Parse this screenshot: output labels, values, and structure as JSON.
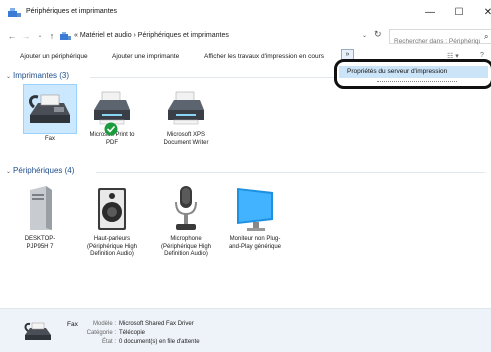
{
  "window": {
    "title": "Périphériques et imprimantes",
    "minimize": "—",
    "maximize": "☐",
    "close": "✕"
  },
  "address": {
    "back": "←",
    "forward": "→",
    "recent": "⌄",
    "up": "↑",
    "path": "« Matériel et audio  ›  Périphériques et imprimantes",
    "dropdown": "⌄",
    "refresh": "↻",
    "search_placeholder": "Rechercher dans : Périphérique",
    "search_icon": "⌕"
  },
  "toolbar": {
    "add_device": "Ajouter un périphérique",
    "add_printer": "Ajouter une imprimante",
    "print_jobs": "Afficher les travaux d'impression en cours",
    "more": "»",
    "view_options": "☷ ▾",
    "help": "?"
  },
  "menu": {
    "server_properties": "Propriétés du serveur d'impression"
  },
  "sections": {
    "printers_header": "Imprimantes (3)",
    "devices_header": "Périphériques (4)",
    "chevron": "⌄"
  },
  "printers": [
    {
      "label": "Fax",
      "icon": "fax-icon",
      "selected": true
    },
    {
      "label": "Microsoft Print to PDF",
      "icon": "printer-icon",
      "default": true
    },
    {
      "label": "Microsoft XPS Document Writer",
      "icon": "printer-icon"
    }
  ],
  "devices": [
    {
      "label": "DESKTOP-PJP95H 7",
      "icon": "computer-tower-icon"
    },
    {
      "label": "Haut-parleurs (Périphérique High Definition Audio)",
      "icon": "speaker-icon"
    },
    {
      "label": "Microphone (Périphérique High Definition Audio)",
      "icon": "microphone-icon"
    },
    {
      "label": "Moniteur non Plug-and-Play générique",
      "icon": "monitor-icon"
    }
  ],
  "details": {
    "name": "Fax",
    "model_label": "Modèle :",
    "model_value": "Microsoft Shared Fax Driver",
    "category_label": "Catégorie :",
    "category_value": "Télécopie",
    "state_label": "État :",
    "state_value": "0 document(s) en file d'attente"
  },
  "colors": {
    "header_text": "#1e4e8c",
    "selection": "#cce8ff",
    "menu_highlight": "#cce4f7",
    "details_bg": "#eef3f9",
    "default_check": "#1a9b3c"
  }
}
